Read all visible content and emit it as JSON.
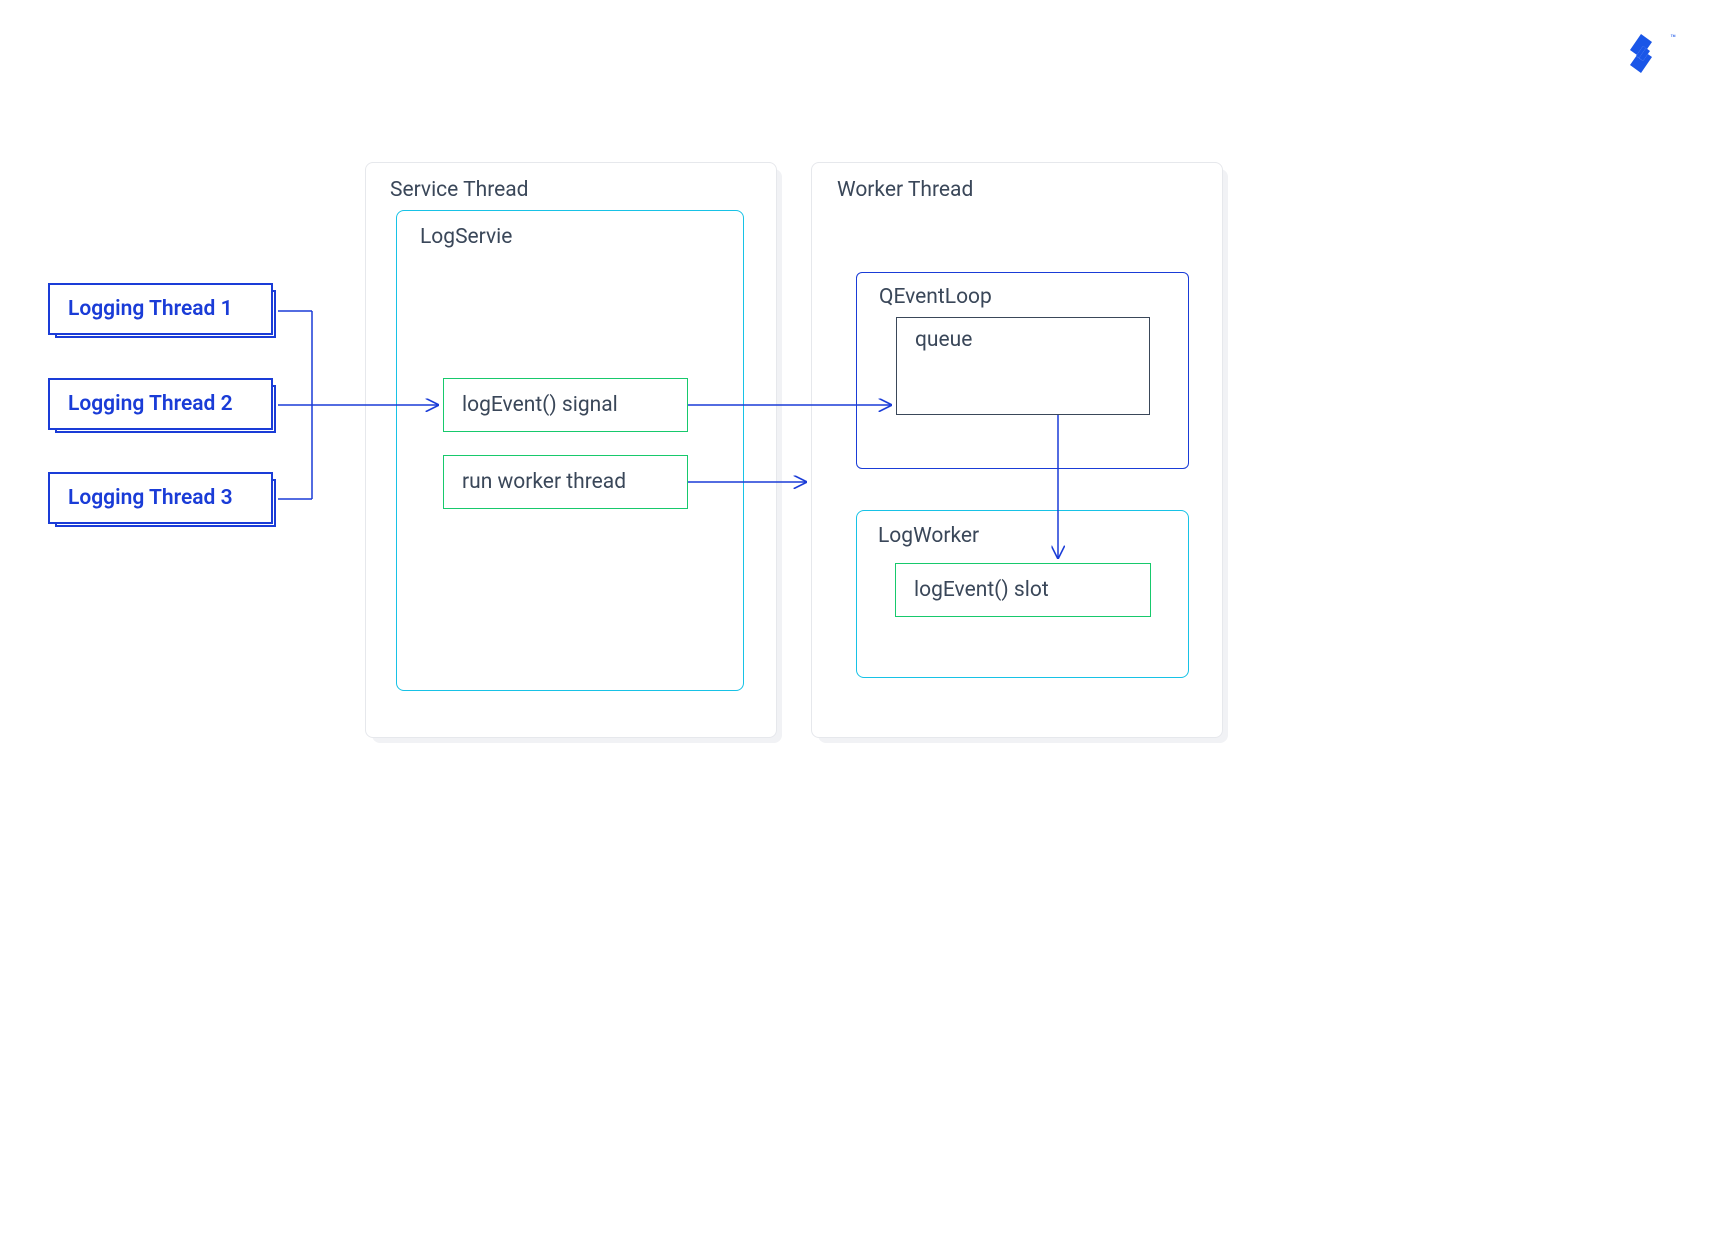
{
  "logo": {
    "tm": "™"
  },
  "threads": {
    "t1": "Logging Thread 1",
    "t2": "Logging Thread 2",
    "t3": "Logging Thread 3"
  },
  "service": {
    "outer_title": "Service Thread",
    "inner_title": "LogServie",
    "signal_box": "logEvent() signal",
    "run_box": "run worker thread"
  },
  "worker": {
    "outer_title": "Worker Thread",
    "eventloop_title": "QEventLoop",
    "queue_label": "queue",
    "logworker_title": "LogWorker",
    "slot_box": "logEvent() slot"
  }
}
